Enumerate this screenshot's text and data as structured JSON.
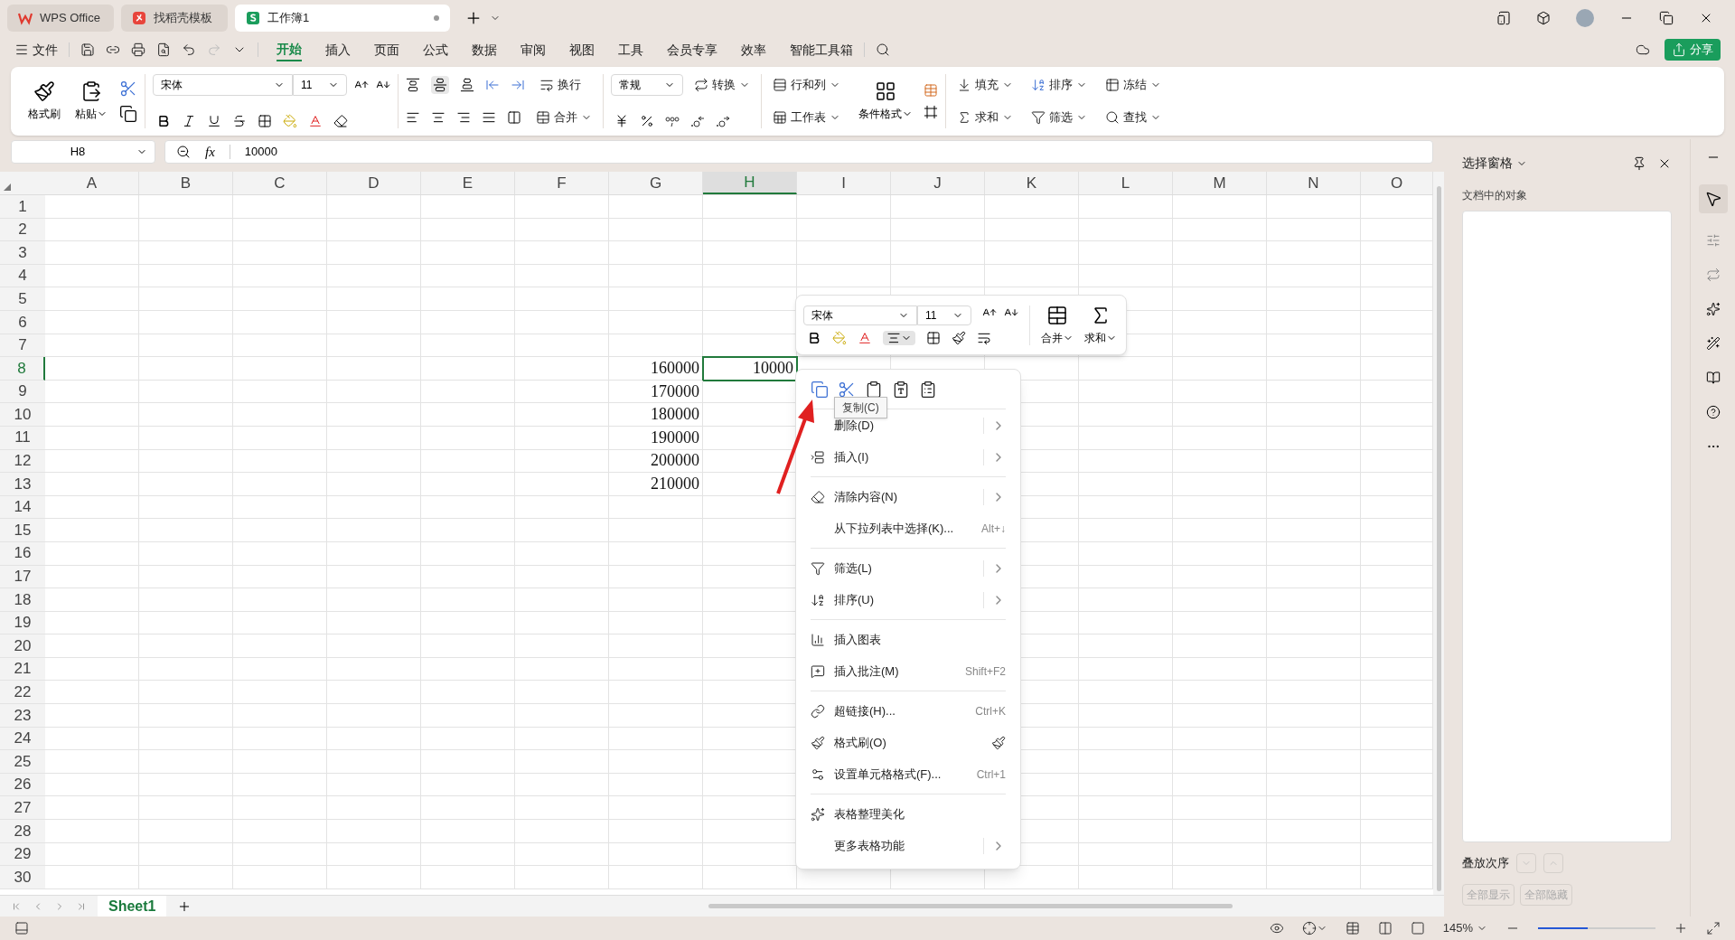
{
  "tabs": [
    {
      "label": "WPS Office",
      "kind": "home",
      "selected": false
    },
    {
      "label": "找稻壳模板",
      "kind": "template",
      "selected": false
    },
    {
      "label": "工作簿1",
      "kind": "sheet",
      "selected": true
    }
  ],
  "menu": {
    "file": "文件",
    "tabs": [
      {
        "label": "开始",
        "selected": true
      },
      {
        "label": "插入",
        "selected": false
      },
      {
        "label": "页面",
        "selected": false
      },
      {
        "label": "公式",
        "selected": false
      },
      {
        "label": "数据",
        "selected": false
      },
      {
        "label": "审阅",
        "selected": false
      },
      {
        "label": "视图",
        "selected": false
      },
      {
        "label": "工具",
        "selected": false
      },
      {
        "label": "会员专享",
        "selected": false
      },
      {
        "label": "效率",
        "selected": false
      },
      {
        "label": "智能工具箱",
        "selected": false
      }
    ],
    "share": "分享"
  },
  "ribbon": {
    "format_painter": "格式刷",
    "paste": "粘贴",
    "font": "宋体",
    "size": "11",
    "wrap": "换行",
    "merge": "合并",
    "number_format": "常规",
    "convert": "转换",
    "rows_cols": "行和列",
    "worksheet": "工作表",
    "conditional": "条件格式",
    "edit": [
      {
        "label": "填充"
      },
      {
        "label": "排序"
      },
      {
        "label": "冻结"
      },
      {
        "label": "求和"
      },
      {
        "label": "筛选"
      },
      {
        "label": "查找"
      }
    ]
  },
  "formula_bar": {
    "cell": "H8",
    "function_label": "fx",
    "value": "10000"
  },
  "columns": [
    {
      "label": "A",
      "selected": false
    },
    {
      "label": "B",
      "selected": false
    },
    {
      "label": "C",
      "selected": false
    },
    {
      "label": "D",
      "selected": false
    },
    {
      "label": "E",
      "selected": false
    },
    {
      "label": "F",
      "selected": false
    },
    {
      "label": "G",
      "selected": false
    },
    {
      "label": "H",
      "selected": true
    },
    {
      "label": "I",
      "selected": false
    },
    {
      "label": "J",
      "selected": false
    },
    {
      "label": "K",
      "selected": false
    },
    {
      "label": "L",
      "selected": false
    },
    {
      "label": "M",
      "selected": false
    },
    {
      "label": "N",
      "selected": false
    },
    {
      "label": "O",
      "selected": false
    }
  ],
  "rows": [
    {
      "label": "1",
      "selected": false
    },
    {
      "label": "2",
      "selected": false
    },
    {
      "label": "3",
      "selected": false
    },
    {
      "label": "4",
      "selected": false
    },
    {
      "label": "5",
      "selected": false
    },
    {
      "label": "6",
      "selected": false
    },
    {
      "label": "7",
      "selected": false
    },
    {
      "label": "8",
      "selected": true,
      "g": "160000",
      "h": "10000"
    },
    {
      "label": "9",
      "selected": false,
      "g": "170000"
    },
    {
      "label": "10",
      "selected": false,
      "g": "180000"
    },
    {
      "label": "11",
      "selected": false,
      "g": "190000"
    },
    {
      "label": "12",
      "selected": false,
      "g": "200000"
    },
    {
      "label": "13",
      "selected": false,
      "g": "210000"
    },
    {
      "label": "14",
      "selected": false
    },
    {
      "label": "15",
      "selected": false
    },
    {
      "label": "16",
      "selected": false
    },
    {
      "label": "17",
      "selected": false
    },
    {
      "label": "18",
      "selected": false
    },
    {
      "label": "19",
      "selected": false
    },
    {
      "label": "20",
      "selected": false
    },
    {
      "label": "21",
      "selected": false
    },
    {
      "label": "22",
      "selected": false
    },
    {
      "label": "23",
      "selected": false
    },
    {
      "label": "24",
      "selected": false
    },
    {
      "label": "25",
      "selected": false
    },
    {
      "label": "26",
      "selected": false
    },
    {
      "label": "27",
      "selected": false
    },
    {
      "label": "28",
      "selected": false
    },
    {
      "label": "29",
      "selected": false
    },
    {
      "label": "30",
      "selected": false
    }
  ],
  "mini_toolbar": {
    "font": "宋体",
    "size": "11",
    "merge": "合并",
    "sum": "求和"
  },
  "context_menu": {
    "tooltip": "复制(C)",
    "items": [
      {
        "kind": "item",
        "label": "删除(D)",
        "submenu": true
      },
      {
        "kind": "item",
        "label": "插入(I)",
        "submenu": true
      },
      {
        "kind": "divider"
      },
      {
        "kind": "item",
        "label": "清除内容(N)",
        "submenu": true
      },
      {
        "kind": "item",
        "label": "从下拉列表中选择(K)...",
        "shortcut": "Alt+↓"
      },
      {
        "kind": "divider"
      },
      {
        "kind": "item",
        "label": "筛选(L)",
        "submenu": true
      },
      {
        "kind": "item",
        "label": "排序(U)",
        "submenu": true
      },
      {
        "kind": "divider"
      },
      {
        "kind": "item",
        "label": "插入图表"
      },
      {
        "kind": "item",
        "label": "插入批注(M)",
        "shortcut": "Shift+F2"
      },
      {
        "kind": "divider"
      },
      {
        "kind": "item",
        "label": "超链接(H)...",
        "shortcut": "Ctrl+K"
      },
      {
        "kind": "item",
        "label": "格式刷(O)"
      },
      {
        "kind": "item",
        "label": "设置单元格格式(F)...",
        "shortcut": "Ctrl+1"
      },
      {
        "kind": "divider"
      },
      {
        "kind": "item",
        "label": "表格整理美化"
      },
      {
        "kind": "item",
        "label": "更多表格功能",
        "submenu": true
      }
    ]
  },
  "selection_pane": {
    "title": "选择窗格",
    "subtitle": "文档中的对象",
    "order_label": "叠放次序",
    "buttons": [
      {
        "label": "全部显示",
        "disabled": true
      },
      {
        "label": "全部隐藏",
        "disabled": true
      }
    ]
  },
  "sheet_tabs": [
    {
      "label": "Sheet1",
      "selected": true
    }
  ],
  "status_bar": {
    "zoom": "145%",
    "zoom_slider": {
      "level": 0.42
    }
  }
}
